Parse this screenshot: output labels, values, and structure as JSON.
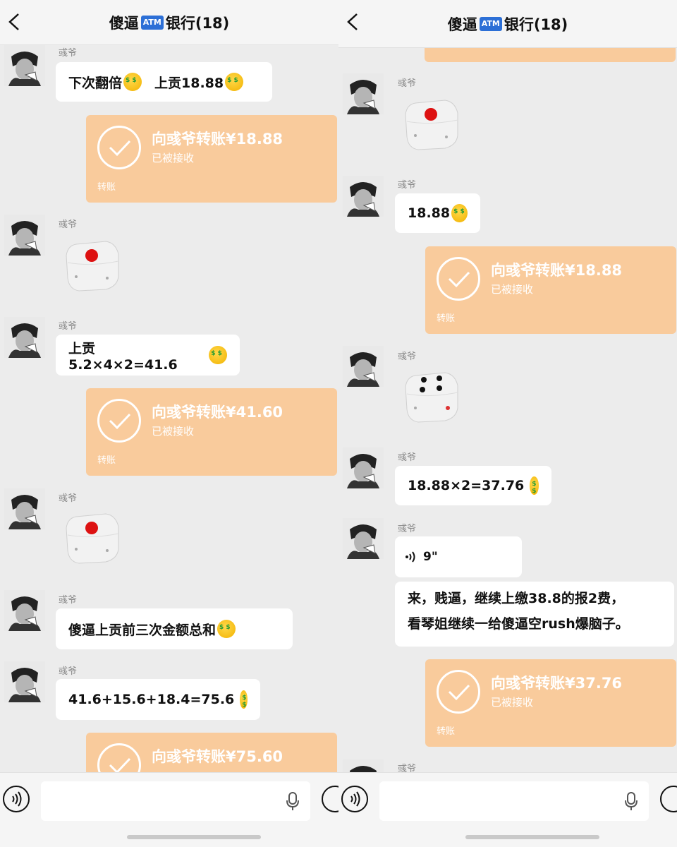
{
  "colors": {
    "transfer_bg": "#f9cb9c",
    "chat_bg": "#ececec",
    "atm_badge": "#2c6fd6"
  },
  "header": {
    "title_pre": "傻逼",
    "atm_badge": "ATM",
    "title_post": "银行(18)"
  },
  "left": {
    "messages": [
      {
        "nick": "彧爷",
        "text": "下次翻倍",
        "text2": "上贡18.88"
      },
      {
        "transfer_title": "向彧爷转账¥18.88",
        "transfer_status": "已被接收",
        "transfer_foot": "转账"
      },
      {
        "nick": "彧爷",
        "dice": 1
      },
      {
        "nick": "彧爷",
        "text": "上贡5.2×4×2=41.6"
      },
      {
        "transfer_title": "向彧爷转账¥41.60",
        "transfer_status": "已被接收",
        "transfer_foot": "转账"
      },
      {
        "nick": "彧爷",
        "dice": 1
      },
      {
        "nick": "彧爷",
        "text": "傻逼上贡前三次金额总和"
      },
      {
        "nick": "彧爷",
        "text": "41.6+15.6+18.4=75.6"
      },
      {
        "transfer_title": "向彧爷转账¥75.60"
      }
    ]
  },
  "right": {
    "messages": [
      {
        "nick": "彧爷",
        "dice": 1
      },
      {
        "nick": "彧爷",
        "text": "18.88"
      },
      {
        "transfer_title": "向彧爷转账¥18.88",
        "transfer_status": "已被接收",
        "transfer_foot": "转账"
      },
      {
        "nick": "彧爷",
        "dice": 4
      },
      {
        "nick": "彧爷",
        "text": "18.88×2=37.76"
      },
      {
        "nick": "彧爷",
        "voice_duration": "9\""
      },
      {
        "text_line1": "来，贱逼，继续上缴38.8的报2费，",
        "text_line2": "看琴姐继续一给傻逼空rush爆脑子。"
      },
      {
        "transfer_title": "向彧爷转账¥37.76",
        "transfer_status": "已被接收",
        "transfer_foot": "转账"
      },
      {
        "nick": "彧爷"
      }
    ]
  }
}
